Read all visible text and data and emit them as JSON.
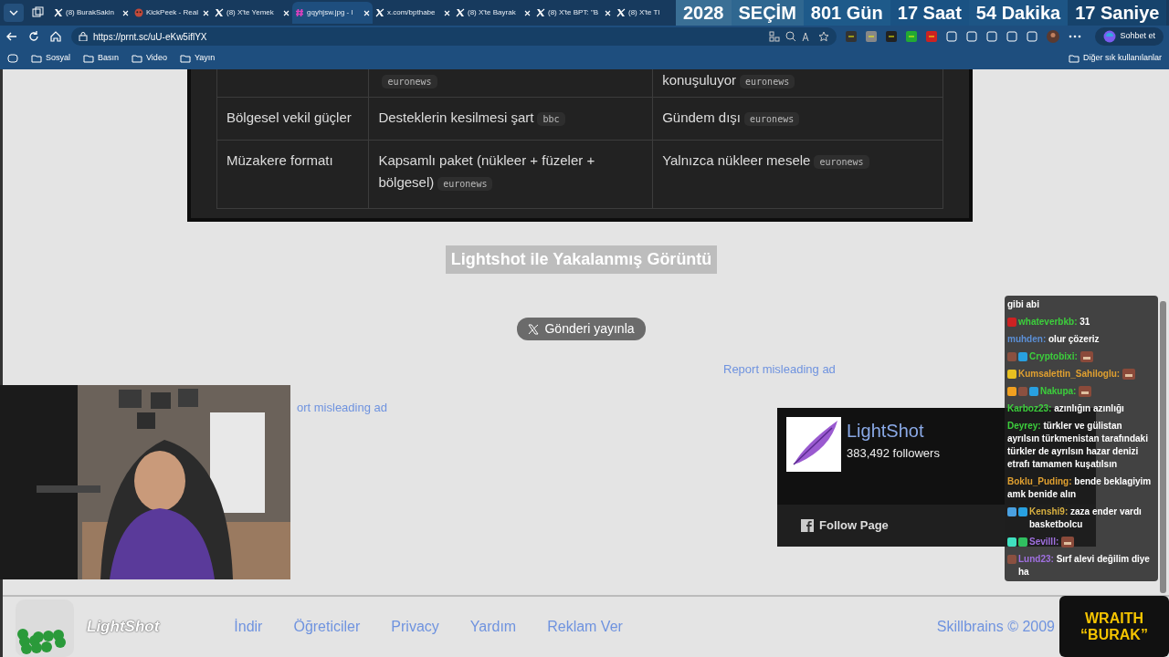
{
  "browser": {
    "tabs": [
      {
        "title": "(8) BurakSakin",
        "kind": "x",
        "selected": false
      },
      {
        "title": "KickPeek - Real",
        "kind": "kick",
        "selected": false
      },
      {
        "title": "(8) X'te Yemek",
        "kind": "x",
        "selected": false
      },
      {
        "title": "gqyhjsw.jpg - l",
        "kind": "hash",
        "selected": true
      },
      {
        "title": "x.com/bpthabe",
        "kind": "x",
        "selected": false
      },
      {
        "title": "(8) X'te Bayrak",
        "kind": "x",
        "selected": false
      },
      {
        "title": "(8) X'te BPT: \"B",
        "kind": "x",
        "selected": false
      },
      {
        "title": "(8) X'te Tl",
        "kind": "x",
        "selected": false
      }
    ],
    "url": "https://prnt.sc/uU-eKw5iflYX",
    "copilot_button": "Sohbet et",
    "bookmarks": [
      "Sosyal",
      "Basın",
      "Video",
      "Yayın"
    ],
    "other_bookmarks": "Diğer sık kullanılanlar"
  },
  "countdown": [
    "2028",
    "SEÇİM",
    "801 Gün",
    "17 Saat",
    "54 Dakika",
    "17 Saniye"
  ],
  "screenshot_table": {
    "rows": [
      {
        "cells": [
          {},
          {
            "tag": "euronews"
          },
          {
            "text": "konuşuluyor",
            "tag": "euronews"
          }
        ]
      },
      {
        "cells": [
          {
            "text": "Bölgesel vekil güçler"
          },
          {
            "text": "Desteklerin kesilmesi şart",
            "tag": "bbc"
          },
          {
            "text": "Gündem dışı",
            "tag": "euronews"
          }
        ]
      },
      {
        "cells": [
          {
            "text": "Müzakere formatı"
          },
          {
            "text": "Kapsamlı paket (nükleer + füzeler + bölgesel)",
            "tag": "euronews"
          },
          {
            "text": "Yalnızca nükleer mesele",
            "tag": "euronews"
          }
        ]
      }
    ]
  },
  "page": {
    "title": "Lightshot ile Yakalanmış Görüntü",
    "share_button": "Gönderi yayınla",
    "report_links": [
      "Report misleading ad",
      "ort misleading ad"
    ]
  },
  "fb_widget": {
    "name": "LightShot",
    "followers": "383,492 followers",
    "follow": "Follow Page"
  },
  "chat": [
    {
      "text": "gibi abi"
    },
    {
      "user": "whateverbkb:",
      "color": "#3ccf3c",
      "text": "31",
      "badges": [
        {
          "color": "#cc2222"
        }
      ]
    },
    {
      "user": "muhden:",
      "color": "#5b8fd6",
      "text": "olur çözeriz"
    },
    {
      "user": "Cryptobixi:",
      "color": "#3ccf3c",
      "badges": [
        {
          "color": "#8a5040"
        },
        {
          "color": "#28a0e0"
        }
      ],
      "emote": true
    },
    {
      "user": "Kumsalettin_Sahiloglu:",
      "color": "#e0a030",
      "badges": [
        {
          "color": "#e8c020"
        }
      ],
      "emote": true
    },
    {
      "user": "Nakupa:",
      "color": "#3ccf3c",
      "badges": [
        {
          "color": "#f0a020"
        },
        {
          "color": "#8a5040"
        },
        {
          "color": "#28a0e0"
        }
      ],
      "emote": true
    },
    {
      "user": "Karboz23:",
      "color": "#3ccf3c",
      "text": "azınlığın azınlığı"
    },
    {
      "user": "Deyrey:",
      "color": "#3ccf3c",
      "text": "türkler ve gülistan ayrılsın türkmenistan tarafındaki türkler de ayrılsın hazar denizi etrafı tamamen kuşatılsın"
    },
    {
      "user": "Boklu_Puding:",
      "color": "#e0a030",
      "text": "bende beklagiyim amk benide alın"
    },
    {
      "user": "Kenshi9:",
      "color": "#d8b040",
      "text": "zaza ender vardı basketbolcu",
      "badges": [
        {
          "color": "#4aa0e0"
        },
        {
          "color": "#28a0e0"
        }
      ]
    },
    {
      "user": "Sevilll:",
      "color": "#a070e0",
      "badges": [
        {
          "color": "#40e0c0"
        },
        {
          "color": "#30c060"
        }
      ],
      "emote": true
    },
    {
      "user": "Lund23:",
      "color": "#a070e0",
      "text": "Sırf alevi değilim diye ha",
      "badges": [
        {
          "color": "#8a5040"
        }
      ]
    }
  ],
  "footer": {
    "logo": "LightShot",
    "links": [
      "İndir",
      "Öğreticiler",
      "Privacy",
      "Yardım",
      "Reklam Ver"
    ],
    "copyright": "Skillbrains © 2009"
  },
  "stream_badge": [
    "WRAITH",
    "“BURAK”"
  ]
}
